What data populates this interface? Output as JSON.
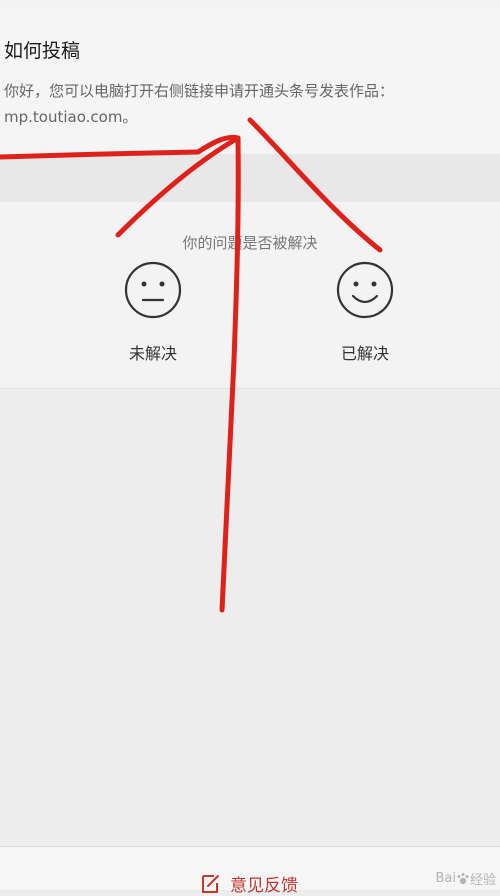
{
  "article": {
    "title": "如何投稿",
    "body": "你好，您可以电脑打开右侧链接申请开通头条号发表作品：mp.toutiao.com。"
  },
  "feedback": {
    "question": "你的问题是否被解决",
    "options": [
      {
        "label": "未解决",
        "icon": "neutral-face-icon"
      },
      {
        "label": "已解决",
        "icon": "smile-face-icon"
      }
    ]
  },
  "bottom_bar": {
    "feedback_label": "意见反馈",
    "icon": "edit-icon"
  },
  "watermark": {
    "logo_text": "Bai",
    "suffix": "经验"
  },
  "colors": {
    "accent": "#c4372e",
    "annotation": "#e0201b"
  }
}
